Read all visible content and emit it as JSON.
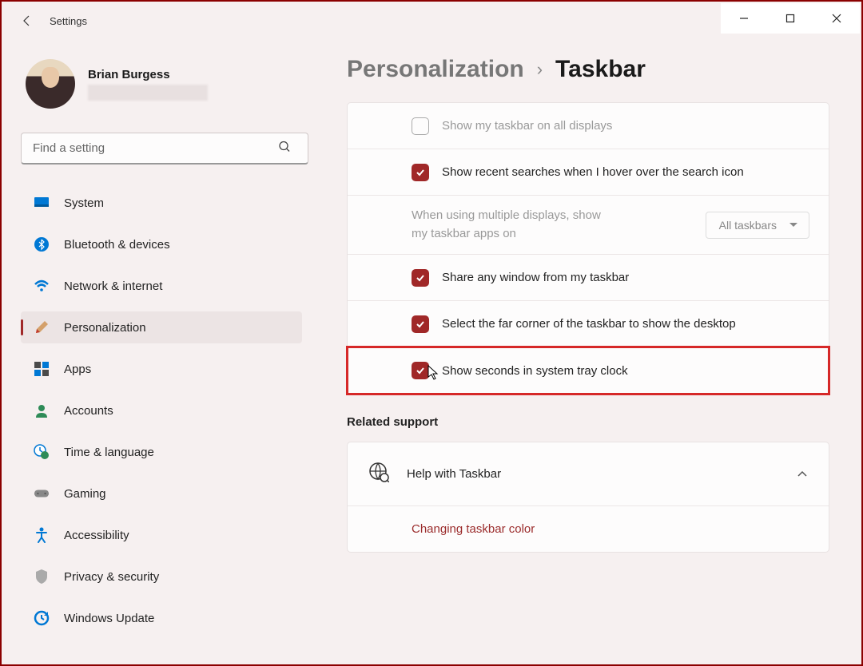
{
  "app": {
    "title": "Settings"
  },
  "profile": {
    "name": "Brian Burgess"
  },
  "search": {
    "placeholder": "Find a setting"
  },
  "sidebar": {
    "items": [
      {
        "label": "System"
      },
      {
        "label": "Bluetooth & devices"
      },
      {
        "label": "Network & internet"
      },
      {
        "label": "Personalization"
      },
      {
        "label": "Apps"
      },
      {
        "label": "Accounts"
      },
      {
        "label": "Time & language"
      },
      {
        "label": "Gaming"
      },
      {
        "label": "Accessibility"
      },
      {
        "label": "Privacy & security"
      },
      {
        "label": "Windows Update"
      }
    ]
  },
  "breadcrumb": {
    "parent": "Personalization",
    "current": "Taskbar"
  },
  "settings": {
    "show_all_displays": "Show my taskbar on all displays",
    "recent_searches": "Show recent searches when I hover over the search icon",
    "multi_display_desc": "When using multiple displays, show my taskbar apps on",
    "multi_display_value": "All taskbars",
    "share_window": "Share any window from my taskbar",
    "far_corner": "Select the far corner of the taskbar to show the desktop",
    "show_seconds": "Show seconds in system tray clock"
  },
  "support": {
    "section_title": "Related support",
    "header": "Help with Taskbar",
    "link1": "Changing taskbar color"
  }
}
